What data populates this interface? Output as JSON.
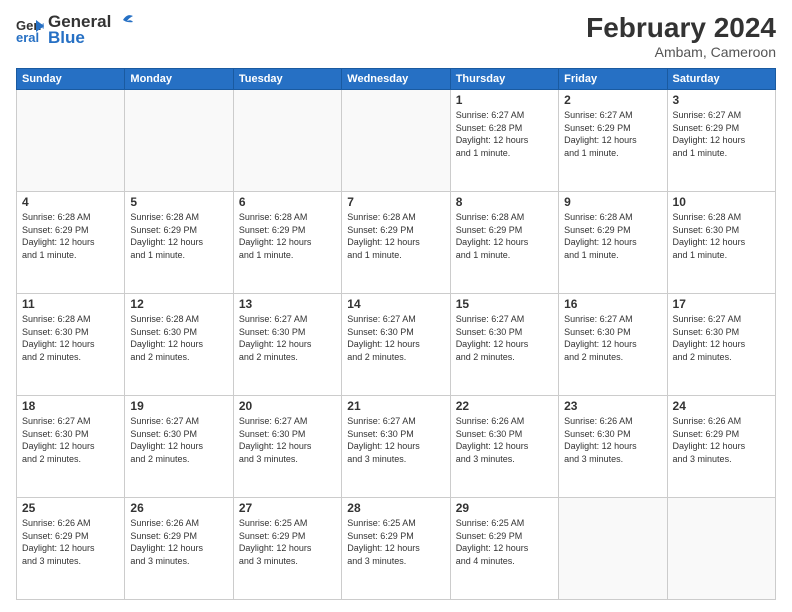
{
  "header": {
    "logo_line1": "General",
    "logo_line2": "Blue",
    "month_year": "February 2024",
    "location": "Ambam, Cameroon"
  },
  "days_of_week": [
    "Sunday",
    "Monday",
    "Tuesday",
    "Wednesday",
    "Thursday",
    "Friday",
    "Saturday"
  ],
  "weeks": [
    [
      {
        "day": "",
        "info": ""
      },
      {
        "day": "",
        "info": ""
      },
      {
        "day": "",
        "info": ""
      },
      {
        "day": "",
        "info": ""
      },
      {
        "day": "1",
        "info": "Sunrise: 6:27 AM\nSunset: 6:28 PM\nDaylight: 12 hours\nand 1 minute."
      },
      {
        "day": "2",
        "info": "Sunrise: 6:27 AM\nSunset: 6:29 PM\nDaylight: 12 hours\nand 1 minute."
      },
      {
        "day": "3",
        "info": "Sunrise: 6:27 AM\nSunset: 6:29 PM\nDaylight: 12 hours\nand 1 minute."
      }
    ],
    [
      {
        "day": "4",
        "info": "Sunrise: 6:28 AM\nSunset: 6:29 PM\nDaylight: 12 hours\nand 1 minute."
      },
      {
        "day": "5",
        "info": "Sunrise: 6:28 AM\nSunset: 6:29 PM\nDaylight: 12 hours\nand 1 minute."
      },
      {
        "day": "6",
        "info": "Sunrise: 6:28 AM\nSunset: 6:29 PM\nDaylight: 12 hours\nand 1 minute."
      },
      {
        "day": "7",
        "info": "Sunrise: 6:28 AM\nSunset: 6:29 PM\nDaylight: 12 hours\nand 1 minute."
      },
      {
        "day": "8",
        "info": "Sunrise: 6:28 AM\nSunset: 6:29 PM\nDaylight: 12 hours\nand 1 minute."
      },
      {
        "day": "9",
        "info": "Sunrise: 6:28 AM\nSunset: 6:29 PM\nDaylight: 12 hours\nand 1 minute."
      },
      {
        "day": "10",
        "info": "Sunrise: 6:28 AM\nSunset: 6:30 PM\nDaylight: 12 hours\nand 1 minute."
      }
    ],
    [
      {
        "day": "11",
        "info": "Sunrise: 6:28 AM\nSunset: 6:30 PM\nDaylight: 12 hours\nand 2 minutes."
      },
      {
        "day": "12",
        "info": "Sunrise: 6:28 AM\nSunset: 6:30 PM\nDaylight: 12 hours\nand 2 minutes."
      },
      {
        "day": "13",
        "info": "Sunrise: 6:27 AM\nSunset: 6:30 PM\nDaylight: 12 hours\nand 2 minutes."
      },
      {
        "day": "14",
        "info": "Sunrise: 6:27 AM\nSunset: 6:30 PM\nDaylight: 12 hours\nand 2 minutes."
      },
      {
        "day": "15",
        "info": "Sunrise: 6:27 AM\nSunset: 6:30 PM\nDaylight: 12 hours\nand 2 minutes."
      },
      {
        "day": "16",
        "info": "Sunrise: 6:27 AM\nSunset: 6:30 PM\nDaylight: 12 hours\nand 2 minutes."
      },
      {
        "day": "17",
        "info": "Sunrise: 6:27 AM\nSunset: 6:30 PM\nDaylight: 12 hours\nand 2 minutes."
      }
    ],
    [
      {
        "day": "18",
        "info": "Sunrise: 6:27 AM\nSunset: 6:30 PM\nDaylight: 12 hours\nand 2 minutes."
      },
      {
        "day": "19",
        "info": "Sunrise: 6:27 AM\nSunset: 6:30 PM\nDaylight: 12 hours\nand 2 minutes."
      },
      {
        "day": "20",
        "info": "Sunrise: 6:27 AM\nSunset: 6:30 PM\nDaylight: 12 hours\nand 3 minutes."
      },
      {
        "day": "21",
        "info": "Sunrise: 6:27 AM\nSunset: 6:30 PM\nDaylight: 12 hours\nand 3 minutes."
      },
      {
        "day": "22",
        "info": "Sunrise: 6:26 AM\nSunset: 6:30 PM\nDaylight: 12 hours\nand 3 minutes."
      },
      {
        "day": "23",
        "info": "Sunrise: 6:26 AM\nSunset: 6:30 PM\nDaylight: 12 hours\nand 3 minutes."
      },
      {
        "day": "24",
        "info": "Sunrise: 6:26 AM\nSunset: 6:29 PM\nDaylight: 12 hours\nand 3 minutes."
      }
    ],
    [
      {
        "day": "25",
        "info": "Sunrise: 6:26 AM\nSunset: 6:29 PM\nDaylight: 12 hours\nand 3 minutes."
      },
      {
        "day": "26",
        "info": "Sunrise: 6:26 AM\nSunset: 6:29 PM\nDaylight: 12 hours\nand 3 minutes."
      },
      {
        "day": "27",
        "info": "Sunrise: 6:25 AM\nSunset: 6:29 PM\nDaylight: 12 hours\nand 3 minutes."
      },
      {
        "day": "28",
        "info": "Sunrise: 6:25 AM\nSunset: 6:29 PM\nDaylight: 12 hours\nand 3 minutes."
      },
      {
        "day": "29",
        "info": "Sunrise: 6:25 AM\nSunset: 6:29 PM\nDaylight: 12 hours\nand 4 minutes."
      },
      {
        "day": "",
        "info": ""
      },
      {
        "day": "",
        "info": ""
      }
    ]
  ]
}
